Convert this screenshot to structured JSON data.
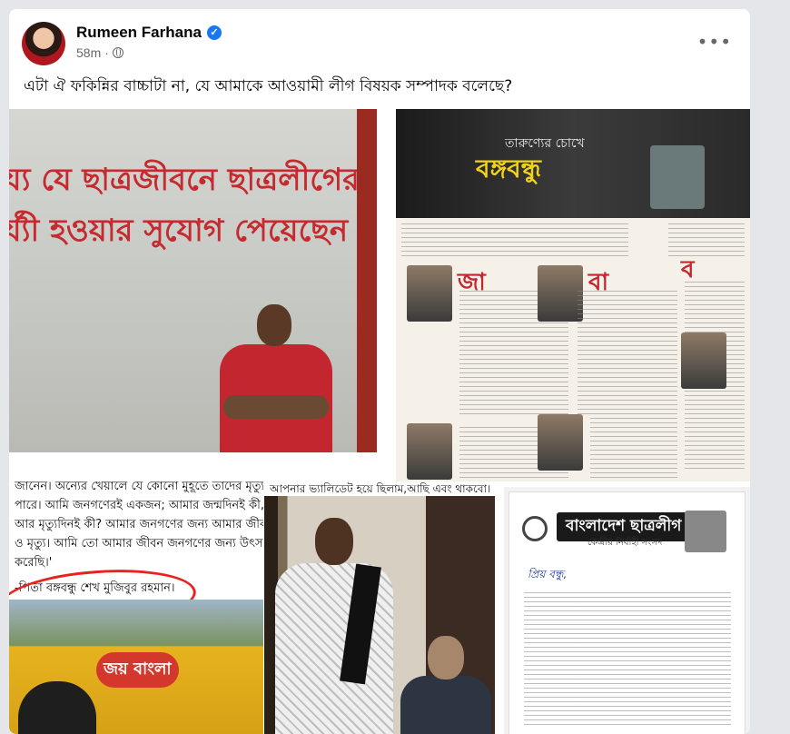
{
  "post": {
    "author": "Rumeen Farhana",
    "timestamp": "58m",
    "text": "এটা ঐ ফকিন্নির বাচ্চাটা না, যে আমাকে আওয়ামী লীগ বিষয়ক সম্পাদক বলেছে?",
    "more_icon": "•••"
  },
  "images": {
    "wall": {
      "line1": "য্য যে ছাত্রজীবনে ছাত্রলীগের",
      "line2": "র্য্যী হওয়ার সুযোগ পেয়েছেন"
    },
    "newspaper": {
      "title": "বঙ্গবন্ধু",
      "subtitle": "তারুণ্যের চোখে"
    },
    "quote": {
      "line1": "জানেন। অন্যের খেয়ালে যে কোনো মুহূর্তে তাদের মৃত্যু হতে",
      "line2": "পারে। আমি জনগণেরই একজন; আমার জন্মদিনই কী,",
      "line3": "আর মৃত্যুদিনই কী? আমার জনগণের জন্য আমার জীবন",
      "line4": "ও মৃত্যু। আমি তো আমার জীবন জনগণের জন্য উৎসর্গ",
      "line5": "করেছি।'",
      "attribution": "-পিতা বঙ্গবন্ধু শেখ মুজিবুর রহমান।",
      "mural_text": "জয় বাংলা"
    },
    "photo_caption": "আপনার ভ্যালিডেট হয়ে ছিলাম,আছি এবং থাকবো।",
    "letter": {
      "org": "বাংলাদেশ ছাত্রলীগ",
      "sub": "কেন্দ্রীয় নির্বাহী সংসদ",
      "name": "প্রিয় বন্ধু,"
    }
  }
}
